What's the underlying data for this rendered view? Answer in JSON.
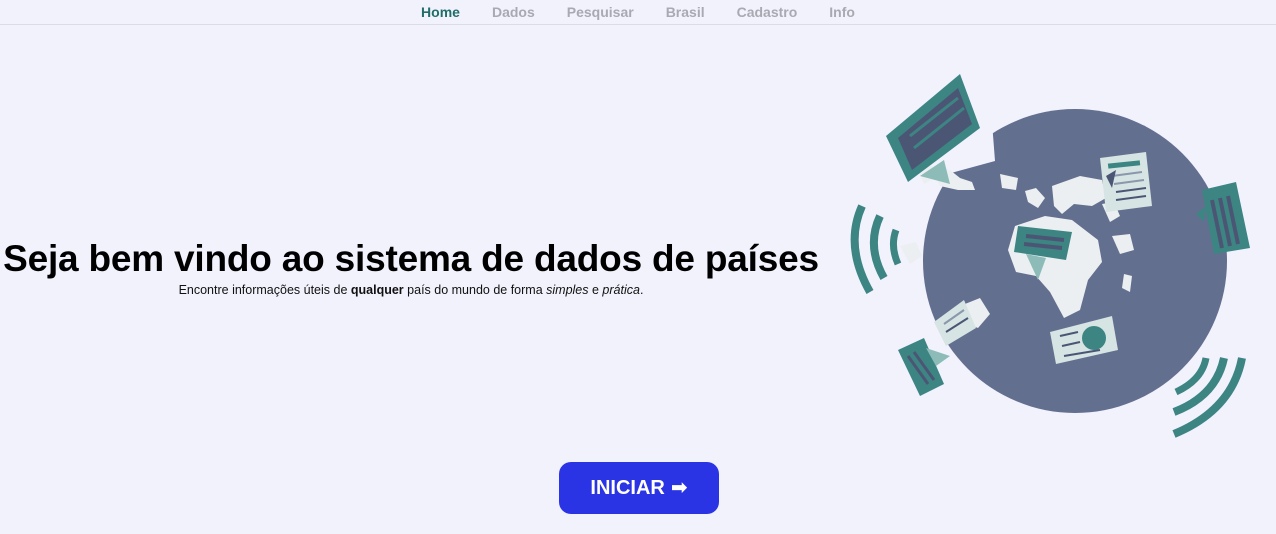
{
  "nav": {
    "items": [
      {
        "label": "Home",
        "active": true
      },
      {
        "label": "Dados",
        "active": false
      },
      {
        "label": "Pesquisar",
        "active": false
      },
      {
        "label": "Brasil",
        "active": false
      },
      {
        "label": "Cadastro",
        "active": false
      },
      {
        "label": "Info",
        "active": false
      }
    ]
  },
  "hero": {
    "title": "Seja bem vindo ao sistema de dados de países",
    "subtitle": {
      "part1": "Encontre informações úteis de ",
      "bold": "qualquer",
      "part2": " país do mundo de forma ",
      "italic1": "simples",
      "part3": " e ",
      "italic2": "prática",
      "part4": "."
    }
  },
  "start_button": {
    "label": "INICIAR",
    "icon": "arrow-right-icon"
  },
  "illustration": {
    "name": "globe-news-illustration"
  },
  "colors": {
    "background": "#f2f2fd",
    "nav_active": "#1f6e6a",
    "nav_inactive": "#a9a9b2",
    "button": "#2a34e4",
    "globe": "#636f8f",
    "teal": "#3d8583",
    "land": "#eceff1"
  }
}
